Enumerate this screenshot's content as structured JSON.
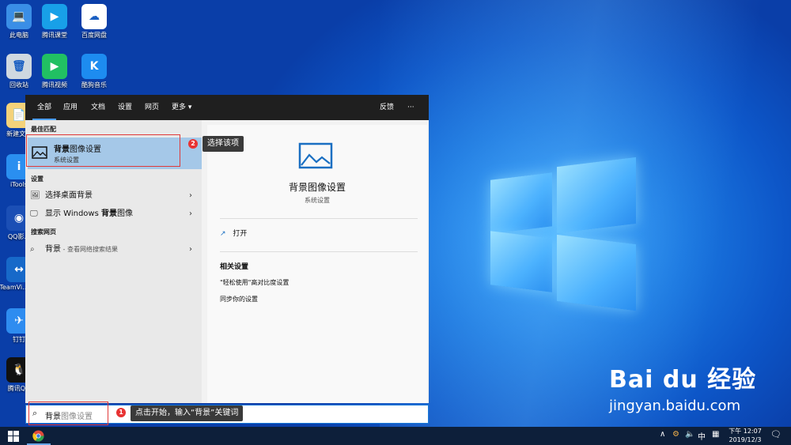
{
  "desktop": {
    "icons": [
      {
        "label": "此电脑",
        "glyph": "💻",
        "color": "#3a8ee6"
      },
      {
        "label": "腾讯课堂",
        "glyph": "▶",
        "color": "#18a0e8"
      },
      {
        "label": "百度网盘",
        "glyph": "☁",
        "color": "#ffffff"
      },
      {
        "label": "回收站",
        "glyph": "🗑",
        "color": "#cfd8e0"
      },
      {
        "label": "腾讯视频",
        "glyph": "▶",
        "color": "#21c063"
      },
      {
        "label": "酷狗音乐",
        "glyph": "K",
        "color": "#1d8cf0"
      },
      {
        "label": "新建文...",
        "glyph": "📄",
        "color": "#f4d27a"
      },
      {
        "label": "iTools",
        "glyph": "i",
        "color": "#2a8ff0"
      },
      {
        "label": "QQ影...",
        "glyph": "◉",
        "color": "#1b4fb5"
      },
      {
        "label": "TeamVi... 14",
        "glyph": "↔",
        "color": "#1769c9"
      },
      {
        "label": "钉钉",
        "glyph": "✈",
        "color": "#2e8cf0"
      },
      {
        "label": "腾讯QQ",
        "glyph": "🐧",
        "color": "#111111"
      }
    ]
  },
  "start_menu": {
    "nav": {
      "tabs": [
        "全部",
        "应用",
        "文档",
        "设置",
        "网页",
        "更多 ▾"
      ],
      "feedback": "反馈",
      "more_icon": "···"
    },
    "best_match_title": "最佳匹配",
    "best_match": {
      "title_bold": "背景",
      "title_rest": "图像设置",
      "subtitle": "系统设置"
    },
    "settings_title": "设置",
    "settings_items": [
      {
        "label": "选择桌面背景",
        "icon": "picture-icon"
      },
      {
        "label_pre": "显示 Windows ",
        "label_bold": "背景",
        "label_post": "图像",
        "icon": "monitor-icon"
      }
    ],
    "web_title": "搜索网页",
    "web_item": {
      "label": "背景",
      "hint": " - 查看网络搜索结果"
    },
    "detail": {
      "title": "背景图像设置",
      "subtitle": "系统设置",
      "open": "打开",
      "related_title": "相关设置",
      "related": [
        "\"轻松使用\"高对比度设置",
        "同步你的设置"
      ]
    }
  },
  "annotations": {
    "step1_badge": "1",
    "step1_text": "点击开始，输入“背景”关键词",
    "step2_badge": "2",
    "step2_text": "选择该项"
  },
  "search": {
    "typed": "背景",
    "suggest": "图像设置"
  },
  "taskbar": {
    "tray_up": "∧",
    "ime": "中",
    "time": "下午 12:07",
    "date": "2019/12/3"
  },
  "watermark": {
    "brand": "Bai du 经验",
    "url": "jingyan.baidu.com"
  }
}
